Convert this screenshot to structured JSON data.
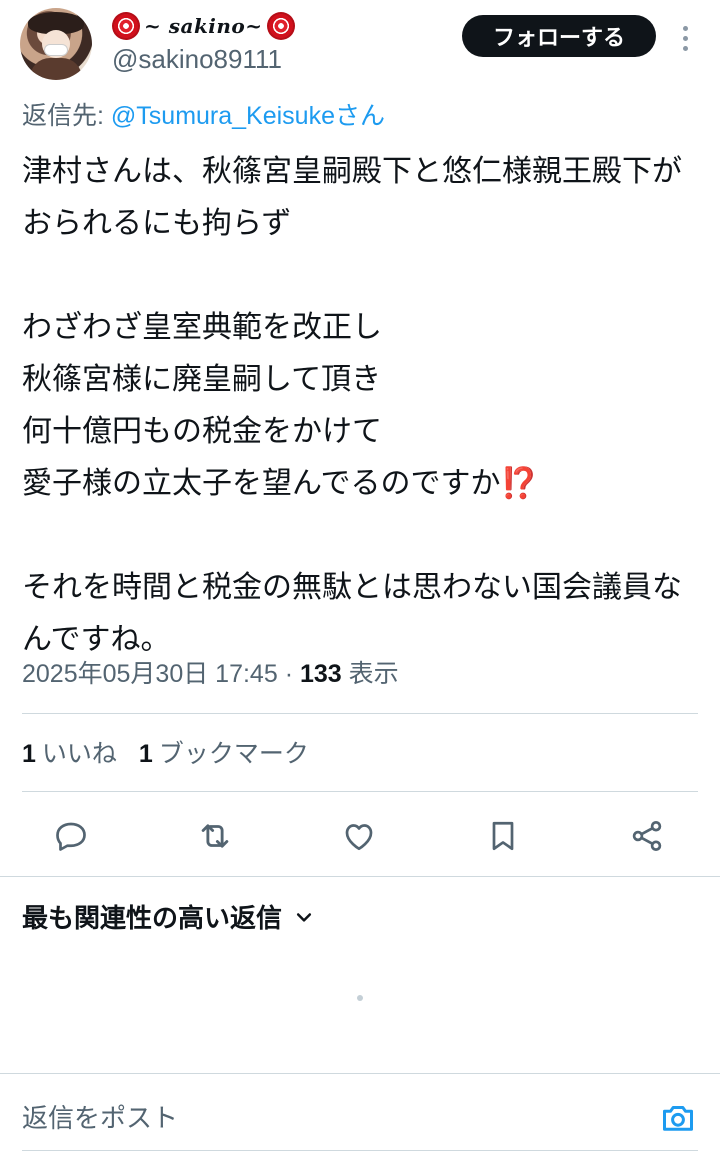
{
  "author": {
    "display_name": "~ sakino~",
    "handle": "@sakino89111"
  },
  "follow_button_label": "フォローする",
  "reply_to": {
    "prefix": "返信先: ",
    "mention": "@Tsumura_Keisuke",
    "suffix": "さん"
  },
  "tweet": {
    "paragraph_1": "津村さんは、秋篠宮皇嗣殿下と悠仁様親王殿下がおられるにも拘らず",
    "paragraph_2": "わざわざ皇室典範を改正し\n秋篠宮様に廃皇嗣して頂き\n何十億円もの税金をかけて\n愛子様の立太子を望んでるのですか",
    "emoji": "⁉️",
    "paragraph_3": "それを時間と税金の無駄とは思わない国会議員なんですね。"
  },
  "meta": {
    "timestamp": "2025年05月30日 17:45",
    "separator": " · ",
    "views_count": "133",
    "views_label": " 表示"
  },
  "stats": {
    "likes_count": "1",
    "likes_label": "いいね",
    "bookmarks_count": "1",
    "bookmarks_label": "ブックマーク"
  },
  "actions": [
    "reply-icon",
    "retweet-icon",
    "like-icon",
    "bookmark-icon",
    "share-icon"
  ],
  "sort_label": "最も関連性の高い返信",
  "compose_placeholder": "返信をポスト",
  "colors": {
    "link": "#1d9bf0",
    "secondary_text": "#536471",
    "primary_text": "#0f1419",
    "emoji": "#e81aa8"
  }
}
